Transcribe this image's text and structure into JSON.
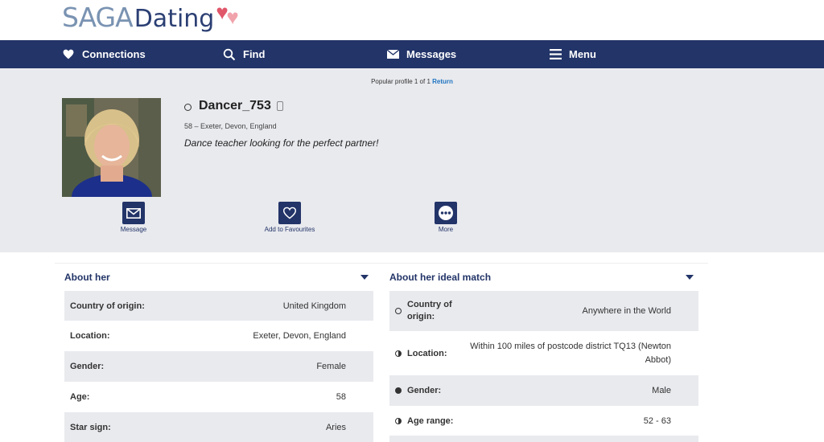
{
  "brand": {
    "saga": "SAGA",
    "dating": "Dating"
  },
  "nav": {
    "items": [
      {
        "label": "Connections",
        "icon": "heart-icon"
      },
      {
        "label": "Find",
        "icon": "search-icon"
      },
      {
        "label": "Messages",
        "icon": "envelope-icon"
      },
      {
        "label": "Menu",
        "icon": "hamburger-icon"
      }
    ]
  },
  "profile": {
    "breadcrumb_text": "Popular profile 1 of 1",
    "breadcrumb_link": "Return",
    "name": "Dancer_753",
    "location": "58 – Exeter, Devon, England",
    "tagline": "Dance teacher looking for the perfect partner!",
    "actions": [
      {
        "label": "Message",
        "icon": "envelope-icon"
      },
      {
        "label": "Add to Favourites",
        "icon": "heart-outline-icon"
      },
      {
        "label": "More",
        "icon": "more-dots-icon"
      }
    ]
  },
  "about_her": {
    "title": "About her",
    "rows": [
      {
        "key": "Country of origin:",
        "value": "United Kingdom"
      },
      {
        "key": "Location:",
        "value": "Exeter, Devon, England"
      },
      {
        "key": "Gender:",
        "value": "Female"
      },
      {
        "key": "Age:",
        "value": "58"
      },
      {
        "key": "Star sign:",
        "value": "Aries"
      }
    ]
  },
  "ideal_match": {
    "title": "About her ideal match",
    "rows": [
      {
        "key": "Country of origin:",
        "value": "Anywhere in the World",
        "bullet": "empty"
      },
      {
        "key": "Location:",
        "value": "Within 100 miles of postcode district TQ13 (Newton Abbot)",
        "bullet": "half"
      },
      {
        "key": "Gender:",
        "value": "Male",
        "bullet": "full"
      },
      {
        "key": "Age range:",
        "value": "52 - 63",
        "bullet": "half"
      }
    ]
  },
  "colors": {
    "navy": "#223468",
    "panel": "#e9eaee",
    "link": "#1f74c0",
    "heart_red": "#e0576a",
    "heart_pink": "#f1a3ab"
  }
}
